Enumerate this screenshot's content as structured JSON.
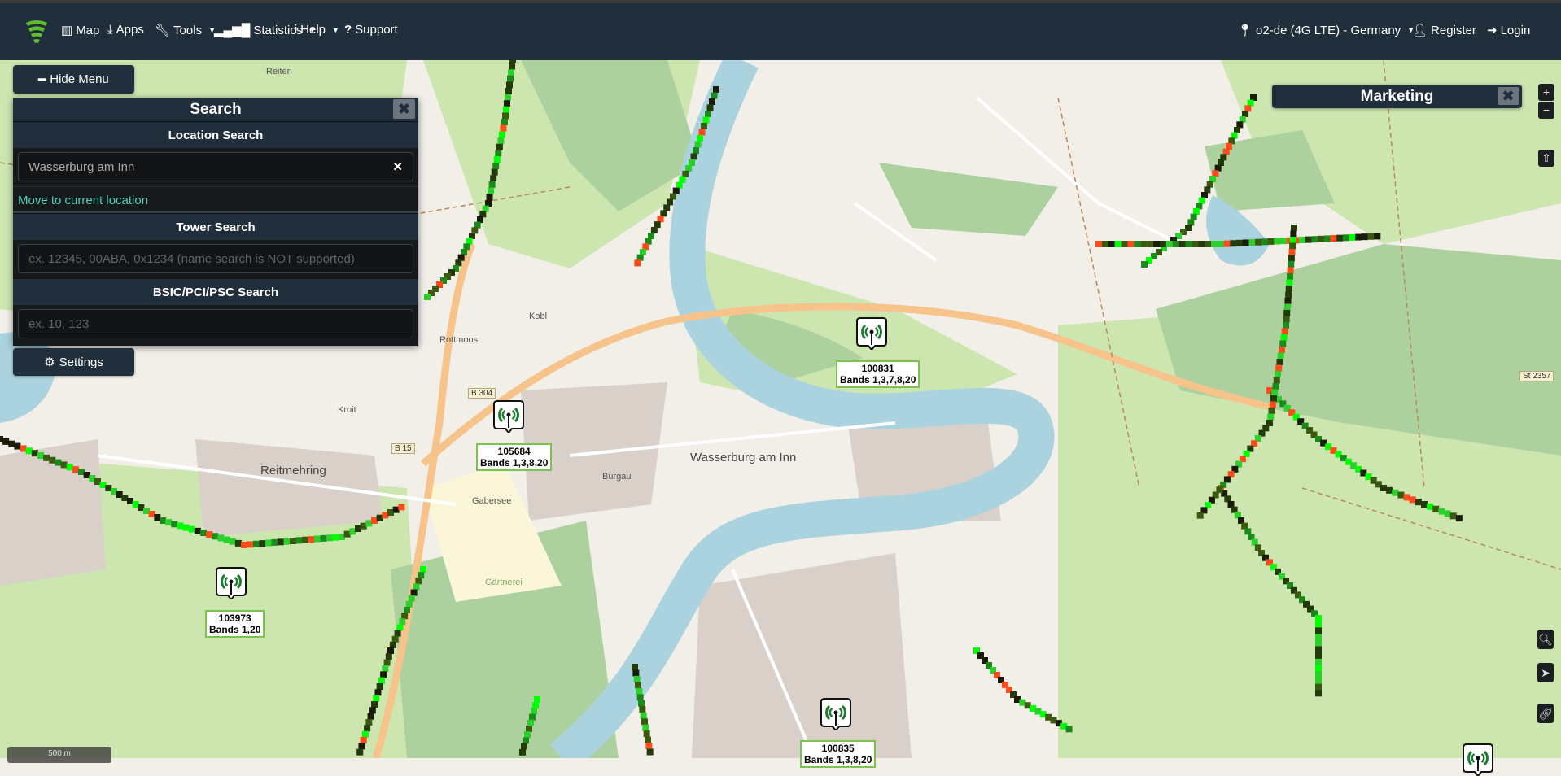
{
  "navbar": {
    "items": [
      {
        "label": "Map",
        "icon": "map-icon"
      },
      {
        "label": "Apps",
        "icon": "download-icon"
      },
      {
        "label": "Tools",
        "icon": "wrench-icon",
        "dropdown": true
      },
      {
        "label": "Statistics",
        "icon": "signal-bars-icon",
        "dropdown": true
      },
      {
        "label": "Help",
        "icon": "info-icon",
        "dropdown": true
      },
      {
        "label": "Support",
        "icon": "question-icon"
      }
    ],
    "network": "o2-de (4G LTE) - Germany",
    "register": "Register",
    "login": "Login"
  },
  "menu": {
    "hide_label": "Hide Menu",
    "settings_label": "Settings"
  },
  "search_panel": {
    "title": "Search",
    "close": "✖",
    "location_header": "Location Search",
    "location_value": "Wasserburg am Inn",
    "clear": "✕",
    "move_link": "Move to current location",
    "tower_header": "Tower Search",
    "tower_placeholder": "ex. 12345, 00ABA, 0x1234 (name search is NOT supported)",
    "bsic_header": "BSIC/PCI/PSC Search",
    "bsic_placeholder": "ex. 10, 123"
  },
  "marketing": {
    "title": "Marketing",
    "close": "✖"
  },
  "controls": {
    "zoom_in": "+",
    "zoom_out": "−",
    "up": "⇧"
  },
  "scale": "500 m",
  "towers": [
    {
      "id": "100831",
      "bands": "Bands 1,3,7,8,20"
    },
    {
      "id": "105684",
      "bands": "Bands 1,3,8,20"
    },
    {
      "id": "103973",
      "bands": "Bands 1,20"
    },
    {
      "id": "100835",
      "bands": "Bands 1,3,8,20"
    }
  ],
  "map_labels": {
    "town": "Wasserburg am Inn",
    "reitmehring": "Reitmehring",
    "gabersee": "Gabersee",
    "burgau": "Burgau",
    "rottmoos": "Rottmoos",
    "kroit": "Kroit",
    "kobl": "Kobl",
    "reiten": "Reiten",
    "b304": "B 304",
    "b15": "B 15",
    "st2357": "St 2357",
    "gaertnerei": "Gärtnerei"
  },
  "colors": {
    "navbar": "#212f3d",
    "link": "#4fd1b5",
    "tower_green": "#1e7d32",
    "river": "#aad3df"
  }
}
